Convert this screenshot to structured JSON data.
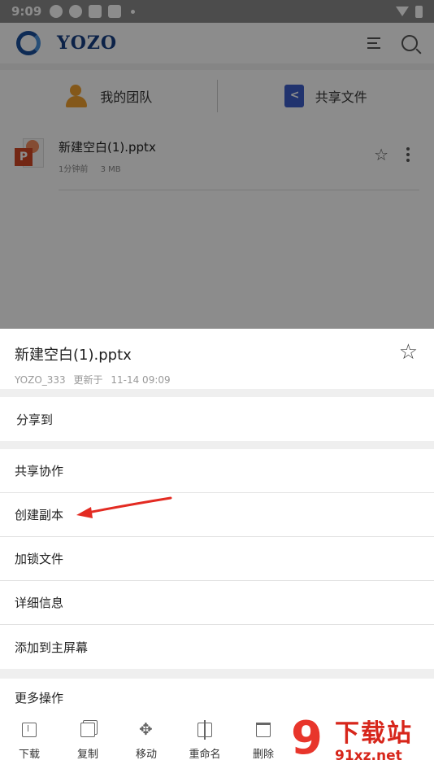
{
  "status_bar": {
    "time": "9:09"
  },
  "app_bar": {
    "logo_text": "YOZO"
  },
  "quick_actions": [
    {
      "label": "我的团队",
      "icon": "team-icon"
    },
    {
      "label": "共享文件",
      "icon": "shared-file-icon"
    }
  ],
  "file": {
    "name": "新建空白(1).pptx",
    "time_ago": "1分钟前",
    "size": "3 MB"
  },
  "sheet": {
    "title": "新建空白(1).pptx",
    "owner": "YOZO_333",
    "updated_label": "更新于",
    "updated_at": "11-14 09:09",
    "share_to": "分享到",
    "items": [
      "共享协作",
      "创建副本",
      "加锁文件",
      "详细信息",
      "添加到主屏幕"
    ],
    "more": "更多操作"
  },
  "toolbar": [
    {
      "label": "下载",
      "icon": "download-icon"
    },
    {
      "label": "复制",
      "icon": "copy-icon"
    },
    {
      "label": "移动",
      "icon": "move-icon"
    },
    {
      "label": "重命名",
      "icon": "rename-icon"
    },
    {
      "label": "删除",
      "icon": "delete-icon"
    }
  ],
  "watermark": {
    "brand": "下载站",
    "url": "91xz.net"
  },
  "colors": {
    "accent_red": "#e8352b",
    "brand_blue": "#163e84",
    "ppt_orange": "#d24726"
  }
}
